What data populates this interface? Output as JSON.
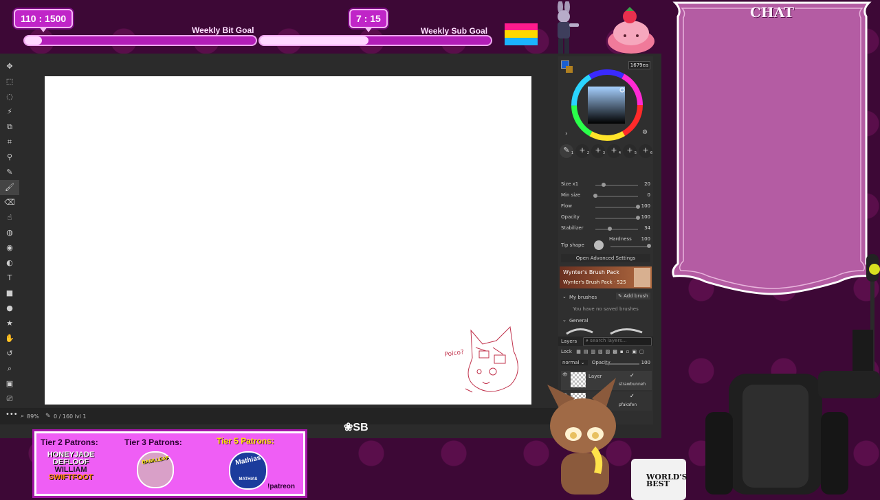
{
  "goals": {
    "bit": {
      "current_label": "110 : 1500",
      "title": "Weekly Bit Goal",
      "progress": 0.073
    },
    "sub": {
      "current_label": "7 : 15",
      "title": "Weekly Sub Goal",
      "progress": 0.47
    }
  },
  "colors": {
    "overlay_bg": "#3d0836",
    "goal_pink": "#c025c8",
    "chat_panel": "#b45ca3",
    "patron_bg": "#ef5ef5"
  },
  "app": {
    "tools": [
      "move-icon",
      "rect-select-icon",
      "lasso-icon",
      "magic-wand-icon",
      "transform-icon",
      "crop-icon",
      "eyedropper-icon",
      "pen-icon",
      "brush-icon",
      "eraser-icon",
      "smudge-icon",
      "blur-icon",
      "fill-icon",
      "gradient-icon",
      "text-icon",
      "rect-icon",
      "ellipse-icon",
      "shape-icon",
      "hand-icon",
      "rotate-icon",
      "zoom-icon",
      "comment-icon",
      "stamp-icon",
      "more-icon"
    ],
    "text_glyphs": {
      "text": "T",
      "more": "•••"
    },
    "status": {
      "zoom": "89%",
      "frames": "0 / 160  lvl 1"
    },
    "sketch_text": "Polco?",
    "logo": "SB"
  },
  "panel": {
    "color_value": "1679ea",
    "brush_slots": [
      "1",
      "2",
      "3",
      "4",
      "5",
      "6"
    ],
    "size": {
      "label": "Size x1",
      "value": "20",
      "pos": 0.2
    },
    "min_size": {
      "label": "Min size",
      "value": "0",
      "pos": 0.0
    },
    "flow": {
      "label": "Flow",
      "value": "100",
      "pos": 1.0
    },
    "opacity": {
      "label": "Opacity",
      "value": "100",
      "pos": 1.0
    },
    "stabilizer": {
      "label": "Stabilizer",
      "value": "34",
      "pos": 0.34
    },
    "tip_shape": "Tip shape",
    "hardness": {
      "label": "Hardness",
      "value": "100",
      "pos": 1.0
    },
    "advanced": "Open Advanced Settings",
    "pack": {
      "title": "Wynter's Brush Pack",
      "sub": "Wynter's Brush Pack · 525"
    },
    "my_brushes": "My brushes",
    "add_brush": "Add brush",
    "no_brushes": "You have no saved brushes",
    "general": "General",
    "layers": {
      "title": "Layers",
      "search_placeholder": "search layers...",
      "lock": "Lock",
      "blend": "normal",
      "opacity_label": "Opacity",
      "opacity_value": "100",
      "items": [
        {
          "name": "Layer",
          "user": "strawbunneh"
        },
        {
          "name": "",
          "user": "pfakafen"
        }
      ]
    }
  },
  "chat": {
    "title": "CHAT"
  },
  "patrons": {
    "tier2": {
      "title": "Tier 2 Patrons:",
      "names": [
        "HONEYJADE",
        "DEFLOOF",
        "WILLIAM",
        "SWIFTFOOT"
      ]
    },
    "tier3": {
      "title": "Tier 3 Patrons:",
      "names": [
        "BASILLEAF"
      ]
    },
    "tier5": {
      "title": "Tier 5 Patrons:",
      "names": [
        "Mathias"
      ],
      "sub": "MATHIAS"
    },
    "command": "!patreon"
  },
  "mug_text": "WORLD'S BEST"
}
